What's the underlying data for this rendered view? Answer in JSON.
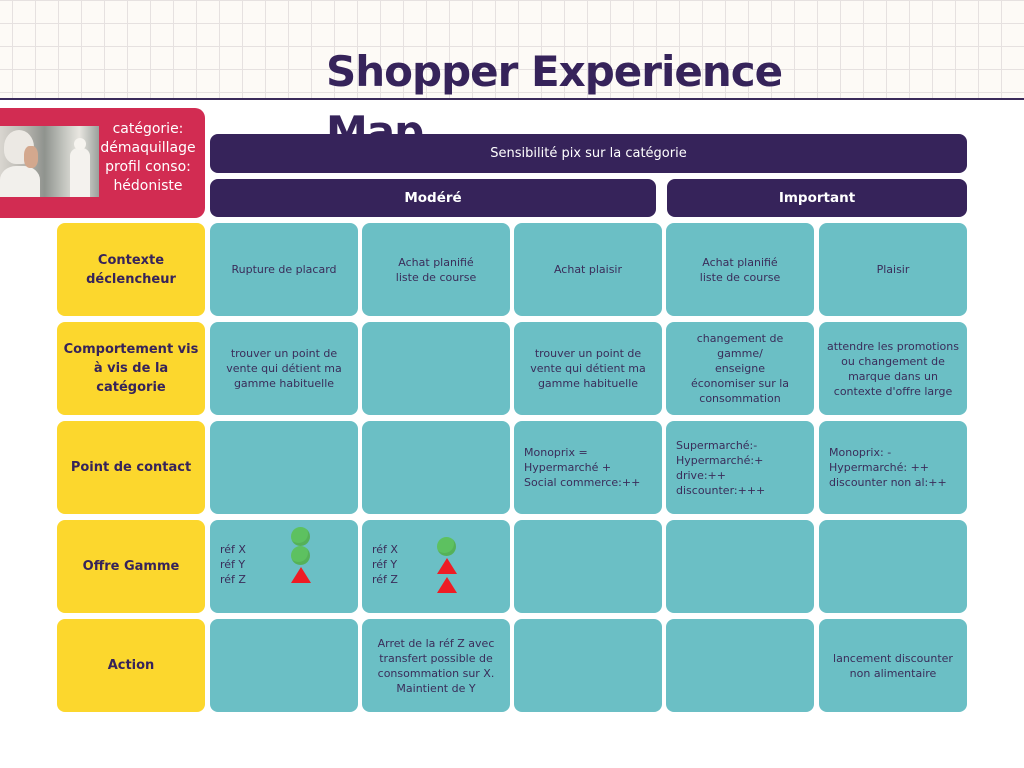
{
  "title": "Shopper Experience Map",
  "category_box": {
    "photo": "woman-removing-makeup-photo",
    "lines": [
      "catégorie:",
      "démaquillage",
      "profil conso:",
      "hédoniste"
    ]
  },
  "headers": {
    "top": "Sensibilité pix sur la catégorie",
    "groups": [
      "Modéré",
      "Important"
    ]
  },
  "colors": {
    "title": "#36235a",
    "category_box": "#d22c52",
    "header": "#36235a",
    "row_label": "#fcd72d",
    "cell": "#6bbfc5",
    "indicator_ok": "#5dc160",
    "indicator_alert": "#ee1c24"
  },
  "rows": [
    {
      "label": "Contexte déclencheur",
      "cells": [
        "Rupture de placard",
        "Achat planifié\nliste de course",
        "Achat plaisir",
        "Achat planifié\nliste de course",
        "Plaisir"
      ]
    },
    {
      "label": "Comportement vis à vis de la catégorie",
      "cells": [
        "trouver un point de vente qui détient ma gamme habituelle",
        "",
        "trouver un point de vente qui détient ma gamme habituelle",
        "changement de gamme/\nenseigne\néconomiser sur la consommation",
        "attendre les promotions ou changement de marque dans un contexte d'offre large"
      ]
    },
    {
      "label": "Point de contact",
      "cells": [
        "",
        "",
        "Monoprix =\nHypermarché +\nSocial commerce:++",
        "Supermarché:-\nHypermarché:+\ndrive:++\ndiscounter:+++",
        "Monoprix: -\nHypermarché: ++\ndiscounter non al:++"
      ]
    },
    {
      "label": "Offre Gamme",
      "cells": [
        "",
        "",
        "",
        "",
        ""
      ],
      "refs": [
        {
          "labels": [
            "réf X",
            "réf Y",
            "réf Z"
          ],
          "indicators": [
            "green-circle",
            "green-circle",
            "red-triangle"
          ]
        },
        {
          "labels": [
            "réf X",
            "réf Y",
            "réf Z"
          ],
          "indicators": [
            "green-circle",
            "red-triangle",
            "red-triangle"
          ]
        }
      ]
    },
    {
      "label": "Action",
      "cells": [
        "",
        "Arret de la réf Z avec transfert possible de consommation sur X. Maintient de Y",
        "",
        "",
        "lancement discounter non alimentaire"
      ]
    }
  ]
}
